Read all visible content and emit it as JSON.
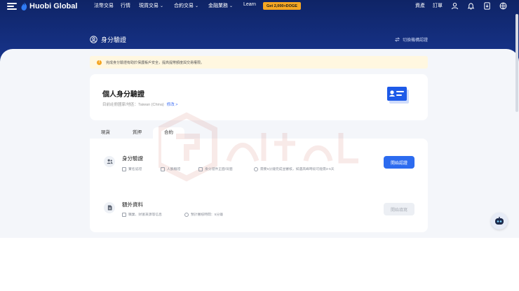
{
  "nav": {
    "logo_text": "Huobi Global",
    "items": [
      {
        "label": "法幣交易",
        "dropdown": false
      },
      {
        "label": "行情",
        "dropdown": false
      },
      {
        "label": "現貨交易",
        "dropdown": true
      },
      {
        "label": "合約交易",
        "dropdown": true
      },
      {
        "label": "金融業務",
        "dropdown": true
      },
      {
        "label": "Learn",
        "dropdown": false
      }
    ],
    "promo": "Get 2,000+DOGE",
    "right_links": [
      "資產",
      "訂單"
    ],
    "icons": [
      "user-icon",
      "bell-icon",
      "download-icon",
      "globe-icon"
    ]
  },
  "page": {
    "title": "身分驗證",
    "switch_label": "切換機構認證"
  },
  "notice": {
    "text": "完成身分驗證有助於保護帳戶安全，提高提幣額度與交易權限。"
  },
  "identity": {
    "title": "個人身分驗證",
    "country_label": "目前註冊國家/地區：Taiwan (China)",
    "edit_label": "修改 >"
  },
  "tabs": [
    "現貨",
    "質押",
    "合約"
  ],
  "verification": {
    "title": "身分驗證",
    "meta": [
      "實名認證",
      "人臉驗證",
      "身分證件正面/背面",
      "需要5分鐘完成並審核，如遇高峰時段可能需3-5天"
    ],
    "button": "開始認證"
  },
  "extra": {
    "title": "額外資料",
    "meta": [
      "職業、財富來源等信息",
      "預計審核時間：5分鐘"
    ],
    "button": "開始填寫"
  },
  "colors": {
    "nav_bg": "#0f2466",
    "hero_bg": "#1a3a9a",
    "primary": "#2c6bef",
    "promo": "#f5a623",
    "notice_bg": "#fff7e0"
  }
}
